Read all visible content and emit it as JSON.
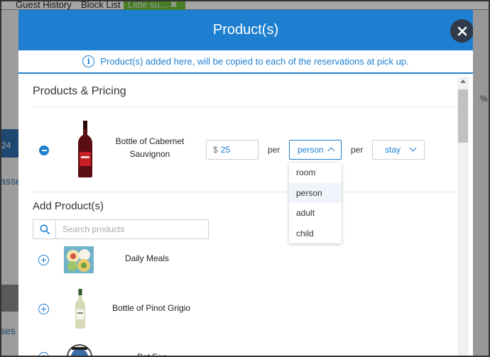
{
  "background": {
    "tabs": [
      "Guest History",
      "Block List",
      "Little su..."
    ],
    "left_fragment_1": "24",
    "left_fragment_2": "asse",
    "left_fragment_3": "ses",
    "right_fragment": "%"
  },
  "modal": {
    "title": "Product(s)",
    "info_text": "Product(s) added here, will be copied to each of the reservations at pick up.",
    "section_pricing": "Products & Pricing",
    "selected_product": {
      "name_line1": "Bottle of Cabernet",
      "name_line2": "Sauvignon",
      "currency": "$",
      "price": "25",
      "per_label_1": "per",
      "unit_selected": "person",
      "per_label_2": "per",
      "period_selected": "stay"
    },
    "unit_options": [
      "room",
      "person",
      "adult",
      "child"
    ],
    "section_add": "Add Product(s)",
    "search_placeholder": "Search products",
    "products": [
      {
        "name": "Daily Meals"
      },
      {
        "name": "Bottle of Pinot Grigio"
      },
      {
        "name": "Pet Fee"
      }
    ]
  },
  "colors": {
    "header_blue": "#1e7fd0",
    "close_bg": "#2f3a4a",
    "tab_green": "#6fbf3a"
  }
}
